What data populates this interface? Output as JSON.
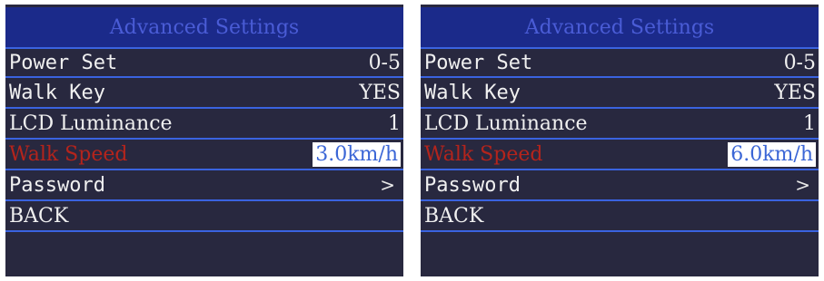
{
  "screens": [
    {
      "title": "Advanced Settings",
      "items": [
        {
          "label": "Power Set",
          "value": "0-5"
        },
        {
          "label": "Walk Key",
          "value": "YES"
        },
        {
          "label": "LCD Luminance",
          "value": "1"
        },
        {
          "label": "Walk Speed",
          "value": "3.0km/h"
        },
        {
          "label": "Password",
          "value": ">"
        },
        {
          "label": "BACK",
          "value": ""
        }
      ]
    },
    {
      "title": "Advanced Settings",
      "items": [
        {
          "label": "Power Set",
          "value": "0-5"
        },
        {
          "label": "Walk Key",
          "value": "YES"
        },
        {
          "label": "LCD Luminance",
          "value": "1"
        },
        {
          "label": "Walk Speed",
          "value": "6.0km/h"
        },
        {
          "label": "Password",
          "value": ">"
        },
        {
          "label": "BACK",
          "value": ""
        }
      ]
    }
  ],
  "colors": {
    "screen_bg": "#28283f",
    "title_bar": "#1b2a8a",
    "title_text": "#4a5cd6",
    "divider": "#3a63e0",
    "active_label": "#b4241c",
    "active_value_bg": "#ffffff",
    "active_value_text": "#3b66d6"
  }
}
